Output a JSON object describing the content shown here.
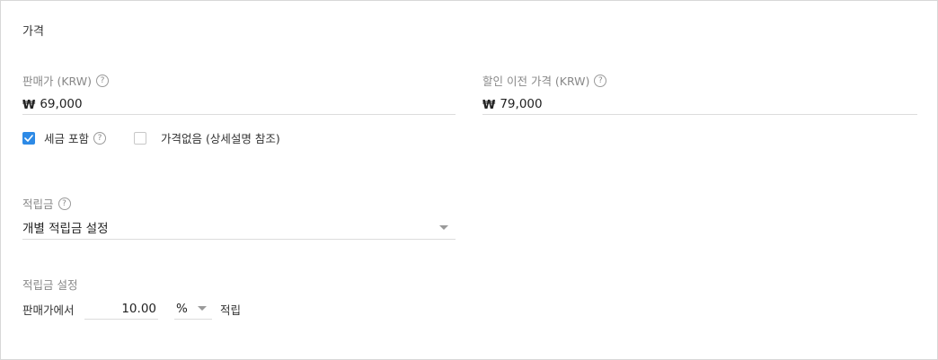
{
  "section": {
    "title": "가격"
  },
  "price": {
    "label": "판매가 (KRW)",
    "currency_symbol": "₩",
    "value": "69,000",
    "tax_included": {
      "label": "세금 포함",
      "checked": true
    },
    "no_price": {
      "label": "가격없음 (상세설명 참조)",
      "checked": false
    }
  },
  "original_price": {
    "label": "할인 이전 가격 (KRW)",
    "currency_symbol": "₩",
    "value": "79,000"
  },
  "points": {
    "label": "적립금",
    "selected": "개별 적립금 설정"
  },
  "points_setting": {
    "label": "적립금 설정",
    "prefix": "판매가에서",
    "rate_value": "10.00",
    "unit": "%",
    "suffix": "적립"
  },
  "icons": {
    "help": "help-circle-icon",
    "check": "check-icon",
    "dropdown": "chevron-down-icon"
  },
  "colors": {
    "accent": "#2d8ae6",
    "label": "#888888",
    "border": "#dcdcdc"
  }
}
